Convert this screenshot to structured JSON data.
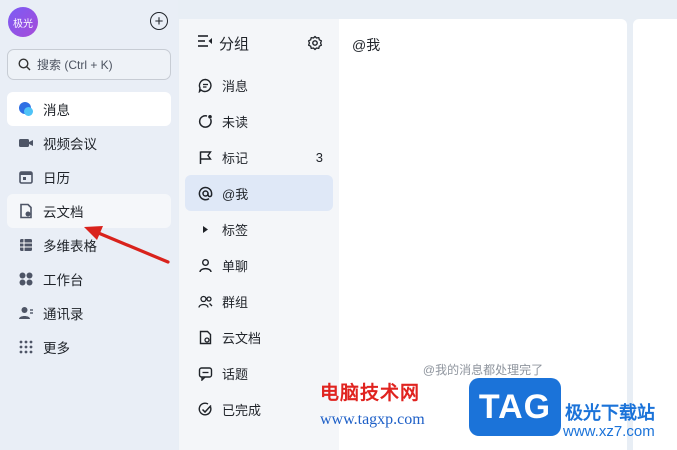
{
  "sidebar": {
    "avatar_text": "极光",
    "search_placeholder": "搜索 (Ctrl + K)",
    "items": [
      {
        "label": "消息",
        "icon": "chat-bubbles-icon"
      },
      {
        "label": "视频会议",
        "icon": "video-camera-icon"
      },
      {
        "label": "日历",
        "icon": "calendar-icon"
      },
      {
        "label": "云文档",
        "icon": "cloud-doc-icon"
      },
      {
        "label": "多维表格",
        "icon": "multi-table-icon"
      },
      {
        "label": "工作台",
        "icon": "workspace-icon"
      },
      {
        "label": "通讯录",
        "icon": "contacts-icon"
      },
      {
        "label": "更多",
        "icon": "more-grid-icon"
      }
    ]
  },
  "groups": {
    "title": "分组",
    "items": [
      {
        "label": "消息",
        "icon": "message-icon"
      },
      {
        "label": "未读",
        "icon": "unread-icon"
      },
      {
        "label": "标记",
        "icon": "flag-icon",
        "count": "3"
      },
      {
        "label": "@我",
        "icon": "at-icon"
      },
      {
        "label": "标签",
        "icon": "caret-right-icon"
      },
      {
        "label": "单聊",
        "icon": "person-icon"
      },
      {
        "label": "群组",
        "icon": "group-icon"
      },
      {
        "label": "云文档",
        "icon": "doc-icon"
      },
      {
        "label": "话题",
        "icon": "topic-icon"
      },
      {
        "label": "已完成",
        "icon": "done-icon"
      }
    ]
  },
  "main": {
    "title": "@我",
    "empty_message": "@我的消息都处理完了"
  },
  "watermark": {
    "site_name": "电脑技术网",
    "site_url": "www.tagxp.com",
    "logo_text": "TAG",
    "brand": "极光下载站",
    "brand_url": "www.xz7.com"
  },
  "colors": {
    "accent": "#1b73d9",
    "selected_group_bg": "#dfe8f7",
    "arrow": "#d9221c"
  }
}
